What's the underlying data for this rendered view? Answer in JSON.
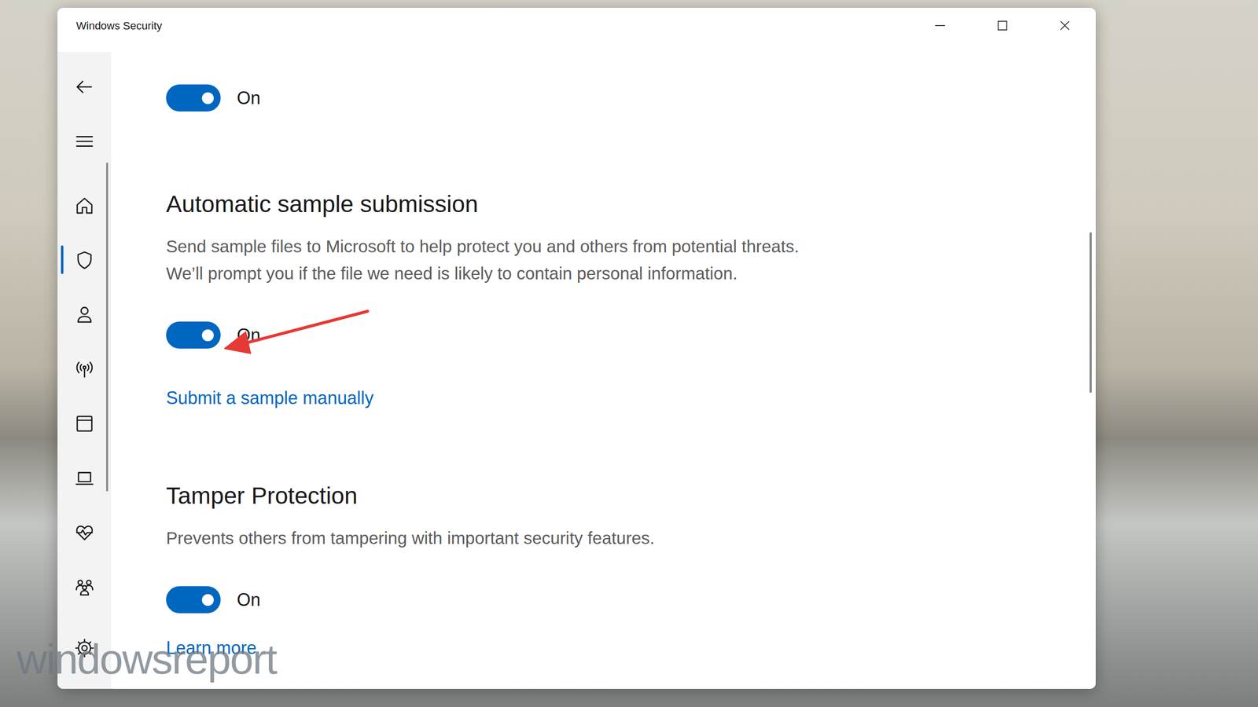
{
  "window": {
    "title": "Windows Security"
  },
  "sidebar": {
    "items": [
      {
        "selected": false
      },
      {
        "selected": true
      },
      {
        "selected": false
      },
      {
        "selected": false
      },
      {
        "selected": false
      },
      {
        "selected": false
      },
      {
        "selected": false
      },
      {
        "selected": false
      },
      {
        "selected": false
      }
    ]
  },
  "sections": [
    {
      "toggle": {
        "on": true,
        "label": "On"
      },
      "links": []
    },
    {
      "heading": "Automatic sample submission",
      "description": "Send sample files to Microsoft to help protect you and others from potential threats. We’ll prompt you if the file we need is likely to contain personal information.",
      "toggle": {
        "on": true,
        "label": "On"
      },
      "links": [
        "Submit a sample manually"
      ]
    },
    {
      "heading": "Tamper Protection",
      "description": "Prevents others from tampering with important security features.",
      "toggle": {
        "on": true,
        "label": "On"
      },
      "links": [
        "Learn more"
      ]
    }
  ],
  "watermark": {
    "text": "windowsreport"
  }
}
